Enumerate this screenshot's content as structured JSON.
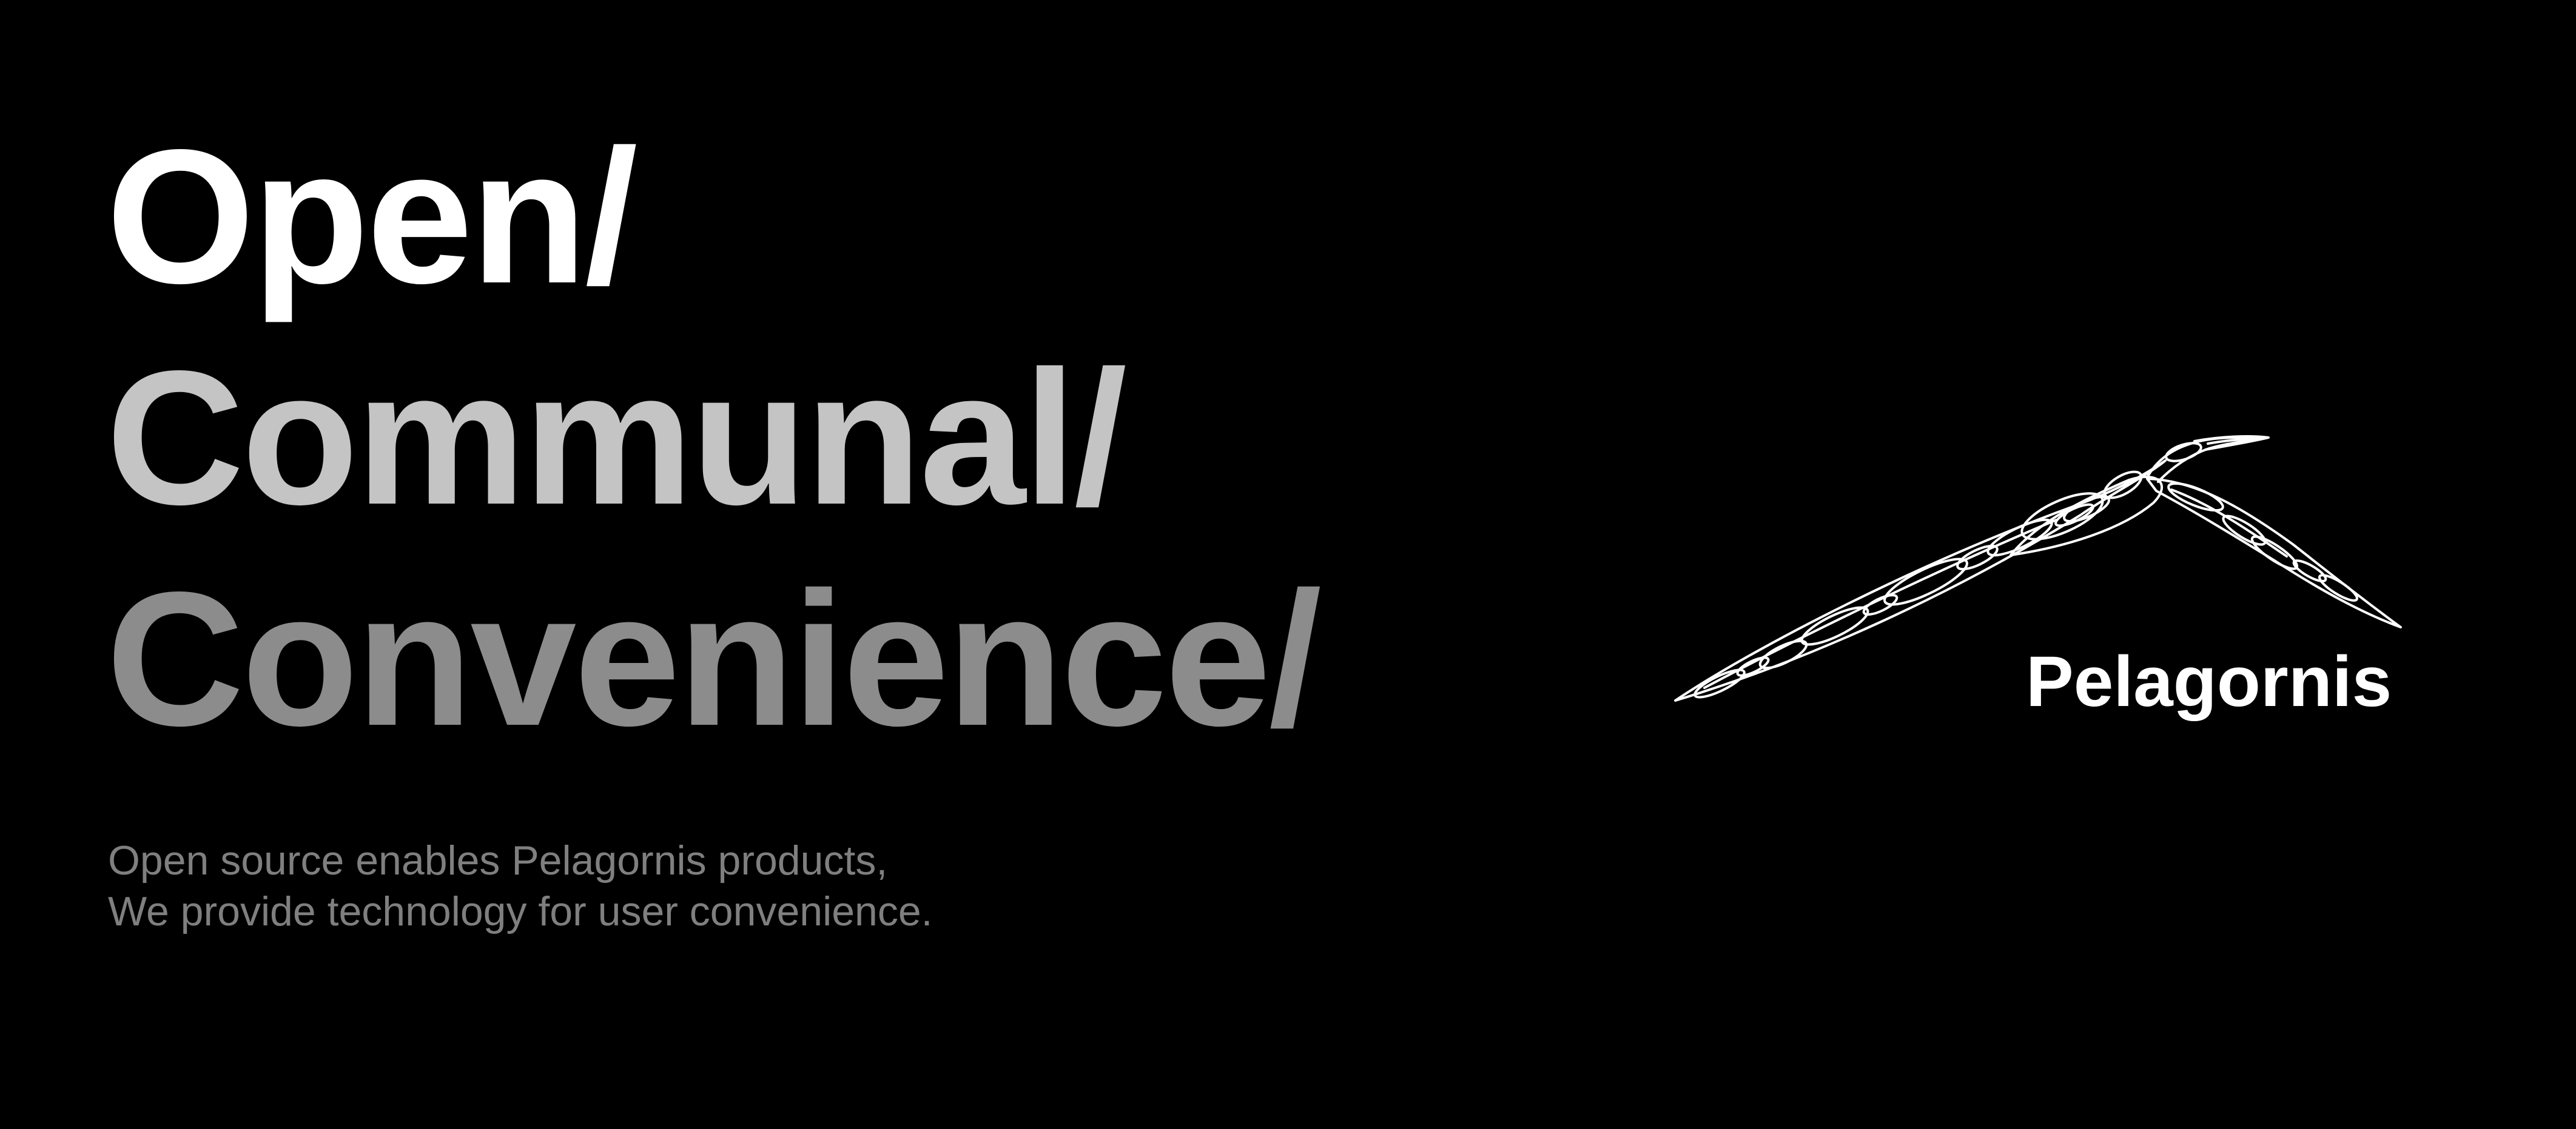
{
  "headline": {
    "lines": [
      {
        "text": "Open/",
        "color": "#ffffff"
      },
      {
        "text": "Communal/",
        "color": "#c4c4c4"
      },
      {
        "text": "Convenience/",
        "color": "#8c8c8c"
      }
    ]
  },
  "tagline": {
    "lines": [
      "Open source enables Pelagornis products,",
      "We provide technology for user convenience."
    ],
    "color": "#7f7f7f"
  },
  "logo": {
    "icon": "bird-outline-icon",
    "name": "Pelagornis"
  },
  "colors": {
    "background": "#000000",
    "logo": "#ffffff"
  }
}
